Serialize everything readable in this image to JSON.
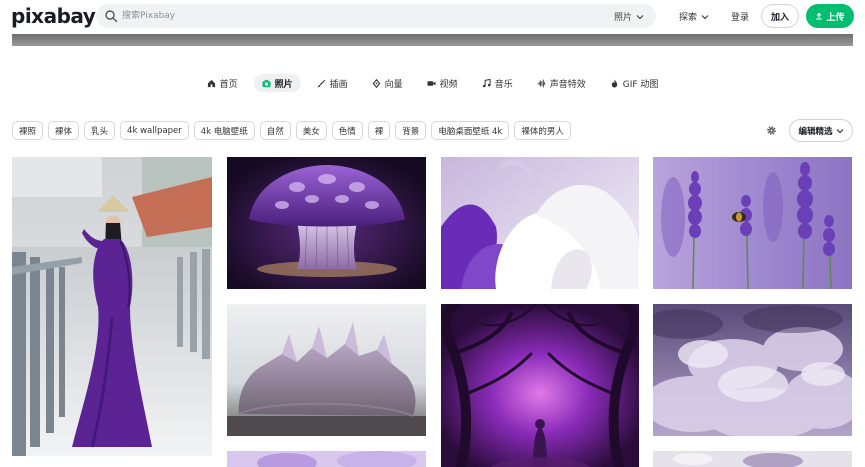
{
  "header": {
    "logo": "pixabay",
    "search_placeholder": "搜索Pixabay",
    "search_type": "照片",
    "explore": "探索",
    "login": "登录",
    "join": "加入",
    "upload": "上传"
  },
  "categories": [
    {
      "label": "首页",
      "icon": "home-icon"
    },
    {
      "label": "照片",
      "icon": "camera-icon",
      "active": true
    },
    {
      "label": "插画",
      "icon": "brush-icon"
    },
    {
      "label": "向量",
      "icon": "vector-icon"
    },
    {
      "label": "视频",
      "icon": "video-icon"
    },
    {
      "label": "音乐",
      "icon": "music-icon"
    },
    {
      "label": "声音特效",
      "icon": "waveform-icon"
    },
    {
      "label": "GIF 动图",
      "icon": "gif-icon"
    }
  ],
  "tags": [
    "裸照",
    "裸体",
    "乳头",
    "4k wallpaper",
    "4k 电脑壁纸",
    "自然",
    "美女",
    "色情",
    "裸",
    "背景",
    "电脑桌面壁纸 4k",
    "裸体的男人"
  ],
  "sort_label": "编辑精选",
  "colors": {
    "brand_green": "#02be6e",
    "accent_purple": "#6a2bb8"
  }
}
